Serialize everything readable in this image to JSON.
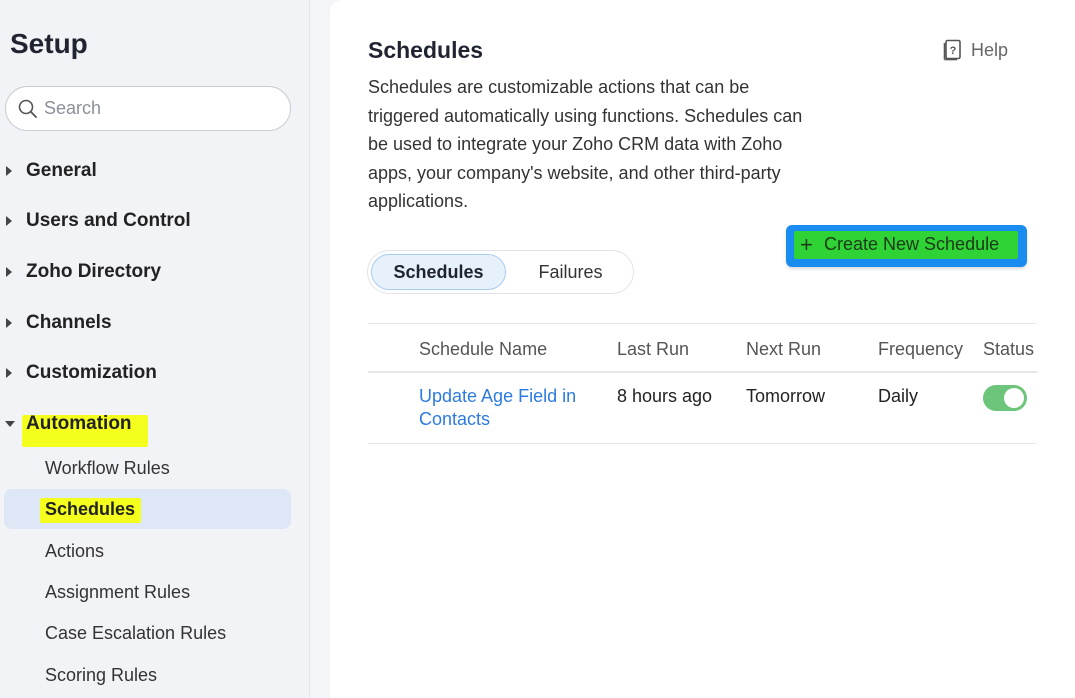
{
  "sidebar": {
    "title": "Setup",
    "search_placeholder": "Search",
    "groups": [
      {
        "label": "General"
      },
      {
        "label": "Users and Control"
      },
      {
        "label": "Zoho Directory"
      },
      {
        "label": "Channels"
      },
      {
        "label": "Customization"
      },
      {
        "label": "Automation"
      }
    ],
    "automation_items": [
      {
        "label": "Workflow Rules"
      },
      {
        "label": "Schedules"
      },
      {
        "label": "Actions"
      },
      {
        "label": "Assignment Rules"
      },
      {
        "label": "Case Escalation Rules"
      },
      {
        "label": "Scoring Rules"
      }
    ]
  },
  "main": {
    "title": "Schedules",
    "help_label": "Help",
    "description": "Schedules are customizable actions that can be triggered automatically using functions. Schedules can be used to integrate your Zoho CRM data with Zoho apps, your company's website, and other third-party applications.",
    "create_button_label": "Create New Schedule",
    "tabs": [
      {
        "label": "Schedules"
      },
      {
        "label": "Failures"
      }
    ],
    "table": {
      "headers": [
        "Schedule Name",
        "Last Run",
        "Next Run",
        "Frequency",
        "Status"
      ],
      "rows": [
        {
          "name": "Update Age Field in Contacts",
          "last_run": "8 hours ago",
          "next_run": "Tomorrow",
          "frequency": "Daily",
          "status": "on"
        }
      ]
    }
  },
  "colors": {
    "accent": "#1a8cf0",
    "highlight_yellow": "#f4ff1e",
    "highlight_green": "#2fd335",
    "link": "#2d7be0",
    "toggle_on": "#6cc57b"
  }
}
